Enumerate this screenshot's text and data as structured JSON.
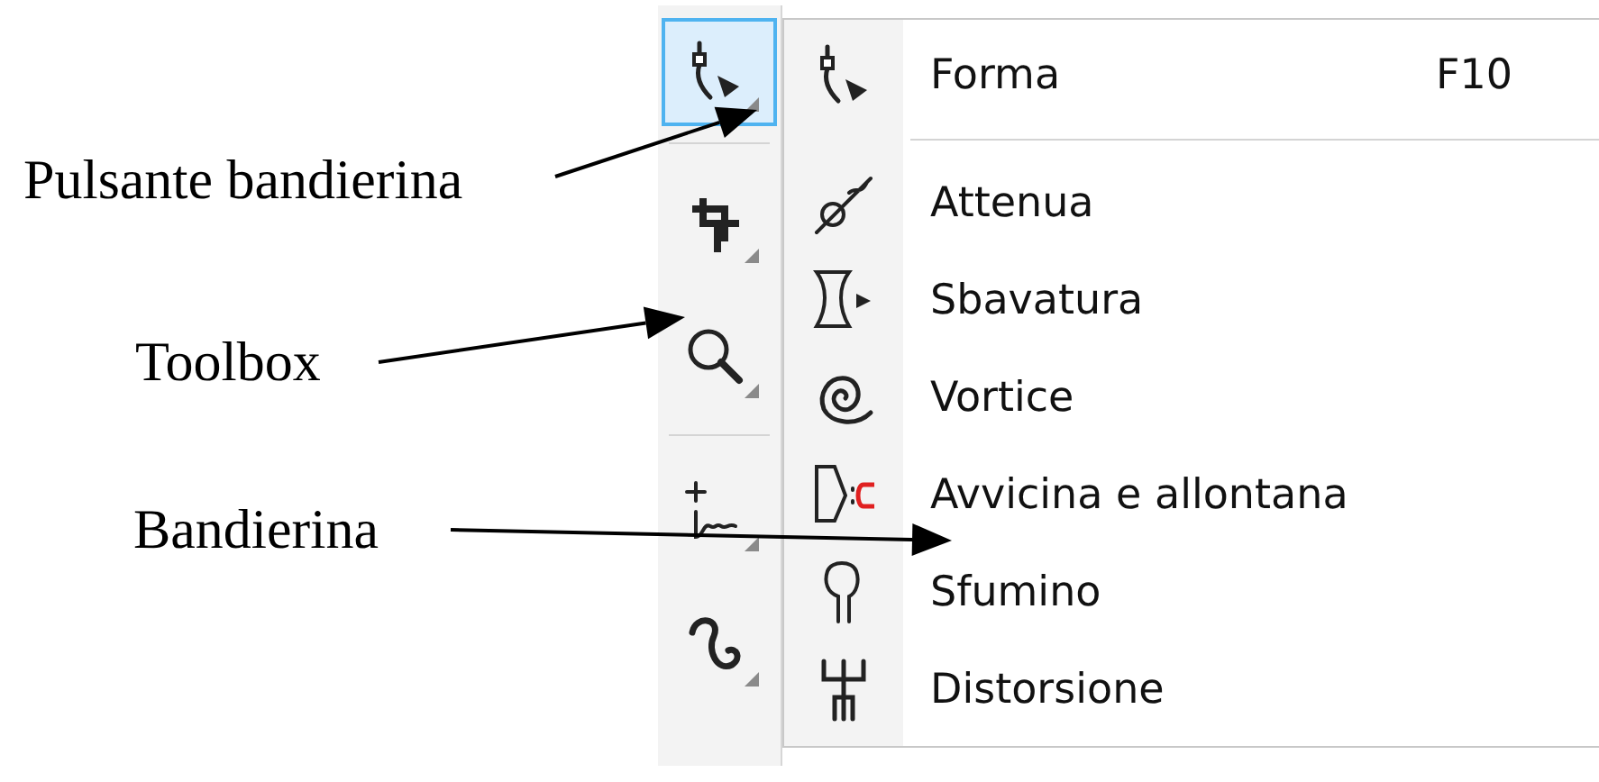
{
  "callouts": [
    {
      "text": "Pulsante bandierina"
    },
    {
      "text": "Toolbox"
    },
    {
      "text": "Bandierina"
    }
  ],
  "toolbox": {
    "groups": [
      [
        {
          "kind": "shape",
          "selected": true
        }
      ],
      [
        {
          "kind": "crop",
          "selected": false
        },
        {
          "kind": "zoom",
          "selected": false
        }
      ],
      [
        {
          "kind": "freehand",
          "selected": false
        },
        {
          "kind": "curve",
          "selected": false
        }
      ]
    ]
  },
  "flyout": {
    "groups": [
      [
        {
          "kind": "shape",
          "label": "Forma",
          "shortcut": "F10"
        }
      ],
      [
        {
          "kind": "smooth",
          "label": "Attenua"
        },
        {
          "kind": "smear",
          "label": "Sbavatura"
        },
        {
          "kind": "twirl",
          "label": "Vortice"
        },
        {
          "kind": "attract",
          "label": "Avvicina e allontana"
        },
        {
          "kind": "smudge",
          "label": "Sfumino"
        },
        {
          "kind": "roughen",
          "label": "Distorsione"
        }
      ]
    ]
  }
}
